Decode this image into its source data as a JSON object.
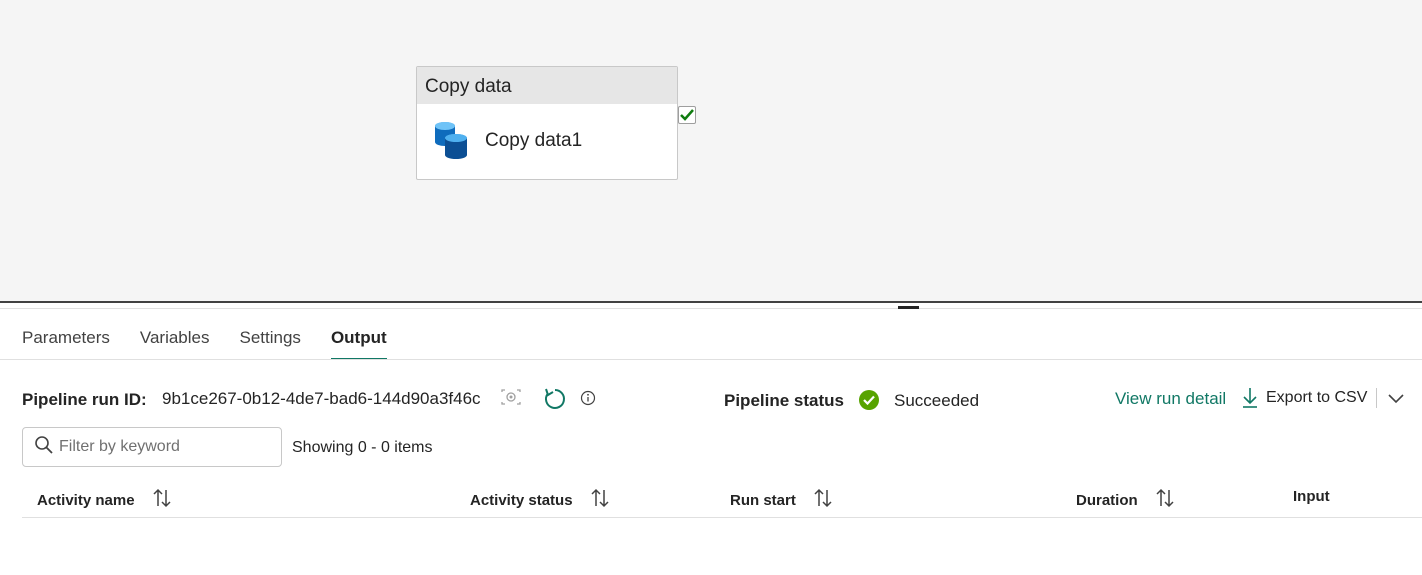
{
  "canvas": {
    "node": {
      "header": "Copy data",
      "label": "Copy data1",
      "icon": "database-icon"
    }
  },
  "tabs": [
    {
      "label": "Parameters",
      "active": false
    },
    {
      "label": "Variables",
      "active": false
    },
    {
      "label": "Settings",
      "active": false
    },
    {
      "label": "Output",
      "active": true
    }
  ],
  "run": {
    "id_label": "Pipeline run ID:",
    "id_value": "9b1ce267-0b12-4de7-bad6-144d90a3f46c",
    "status_label": "Pipeline status",
    "status_value": "Succeeded",
    "view_detail": "View run detail",
    "export": "Export to CSV"
  },
  "filter": {
    "placeholder": "Filter by keyword",
    "showing": "Showing 0 - 0 items"
  },
  "table": {
    "columns": [
      "Activity name",
      "Activity status",
      "Run start",
      "Duration",
      "Input"
    ]
  },
  "colors": {
    "accent": "#117865",
    "success": "#57a300"
  }
}
